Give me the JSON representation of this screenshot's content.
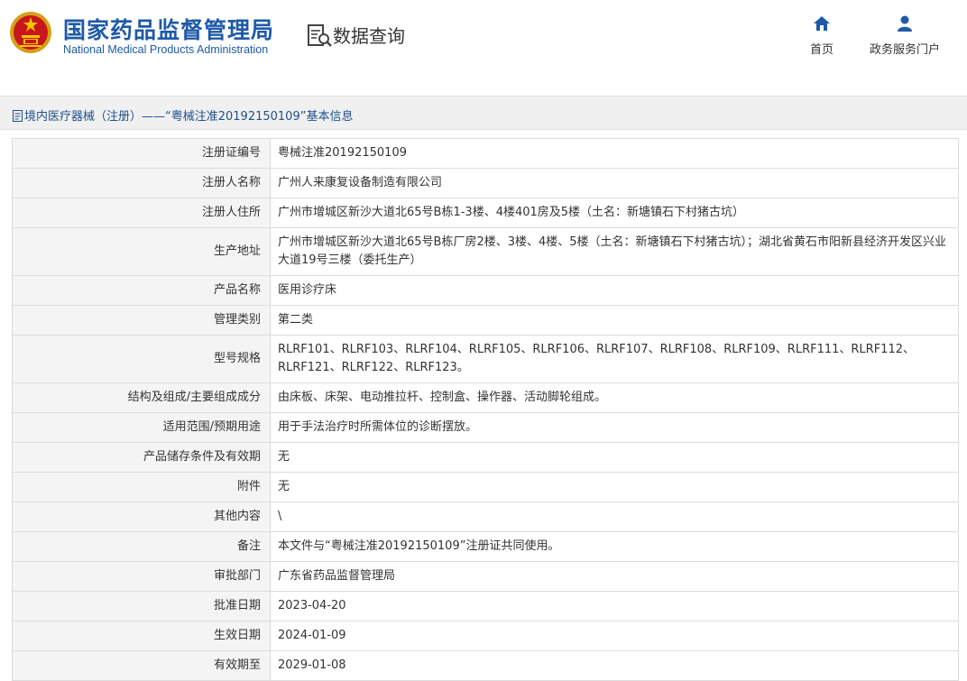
{
  "header": {
    "org_name_cn": "国家药品监督管理局",
    "org_name_en": "National Medical Products Administration",
    "section_title": "数据查询",
    "nav": {
      "home_label": "首页",
      "portal_label": "政务服务门户"
    }
  },
  "breadcrumb": {
    "text": "境内医疗器械（注册）——“粤械注准20192150109”基本信息"
  },
  "colors": {
    "brand_blue": "#1e5aa8",
    "label_bg": "#f4f4f4",
    "border": "#dcdcdc"
  },
  "record": [
    {
      "label": "注册证编号",
      "value": "粤械注准20192150109"
    },
    {
      "label": "注册人名称",
      "value": "广州人来康复设备制造有限公司"
    },
    {
      "label": "注册人住所",
      "value": "广州市增城区新沙大道北65号B栋1-3楼、4楼401房及5楼（土名：新塘镇石下村猪古坑）"
    },
    {
      "label": "生产地址",
      "value": "广州市增城区新沙大道北65号B栋厂房2楼、3楼、4楼、5楼（土名：新塘镇石下村猪古坑）；湖北省黄石市阳新县经济开发区兴业大道19号三楼（委托生产）"
    },
    {
      "label": "产品名称",
      "value": "医用诊疗床"
    },
    {
      "label": "管理类别",
      "value": "第二类"
    },
    {
      "label": "型号规格",
      "value": "RLRF101、RLRF103、RLRF104、RLRF105、RLRF106、RLRF107、RLRF108、RLRF109、RLRF111、RLRF112、RLRF121、RLRF122、RLRF123。"
    },
    {
      "label": "结构及组成/主要组成成分",
      "value": "由床板、床架、电动推拉杆、控制盒、操作器、活动脚轮组成。"
    },
    {
      "label": "适用范围/预期用途",
      "value": "用于手法治疗时所需体位的诊断摆放。"
    },
    {
      "label": "产品储存条件及有效期",
      "value": "无"
    },
    {
      "label": "附件",
      "value": "无"
    },
    {
      "label": "其他内容",
      "value": "\\"
    },
    {
      "label": "备注",
      "value": "本文件与“粤械注准20192150109”注册证共同使用。"
    },
    {
      "label": "审批部门",
      "value": "广东省药品监督管理局"
    },
    {
      "label": "批准日期",
      "value": "2023-04-20"
    },
    {
      "label": "生效日期",
      "value": "2024-01-09"
    },
    {
      "label": "有效期至",
      "value": "2029-01-08"
    }
  ]
}
